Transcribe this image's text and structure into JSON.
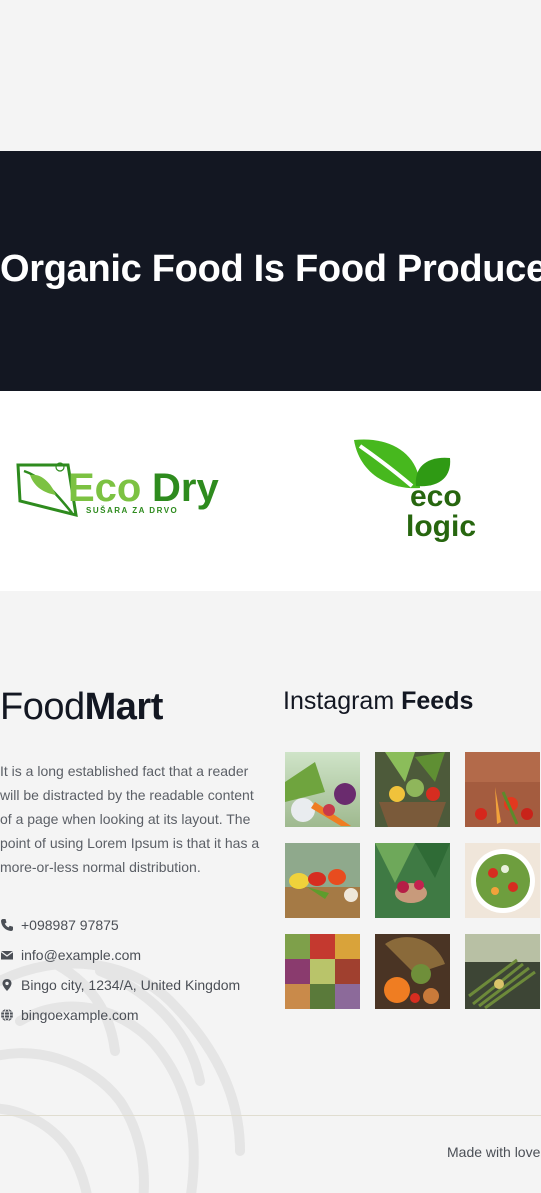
{
  "banner": {
    "heading": "Organic Food Is Food Produce"
  },
  "brands": {
    "ecodry": {
      "word1": "Eco",
      "word2": "Dry",
      "tagline": "SUŠARA ZA DRVO"
    },
    "ecologic": {
      "line1": "eco",
      "line2": "logic"
    }
  },
  "footer": {
    "logo": {
      "light": "Food",
      "bold": "Mart"
    },
    "description": "It is a long established fact that a reader will be distracted by the readable content of a page when looking at its layout. The point of using Lorem Ipsum is that it has a more-or-less normal distribution.",
    "contacts": [
      {
        "icon": "phone-icon",
        "text": "+098987 97875"
      },
      {
        "icon": "envelope-icon",
        "text": "info@example.com"
      },
      {
        "icon": "map-pin-icon",
        "text": "Bingo city, 1234/A, United Kingdom"
      },
      {
        "icon": "globe-icon",
        "text": "bingoexample.com"
      }
    ],
    "instagram": {
      "title_light": "Instagram",
      "title_bold": "Feeds",
      "photos": [
        "vegetable-basket-photo",
        "vegetable-wicker-basket-photo",
        "tomatoes-on-soil-photo",
        "peppers-and-garlic-photo",
        "radish-in-hand-photo",
        "salad-bowl-photo",
        "market-produce-photo",
        "pumpkin-harvest-photo",
        "asparagus-photo"
      ]
    },
    "credit": "Made with love"
  },
  "colors": {
    "banner_bg": "#131722",
    "page_bg": "#f4f4f4",
    "brand_green": "#2e8b1e",
    "leaf_green": "#47b81e"
  }
}
